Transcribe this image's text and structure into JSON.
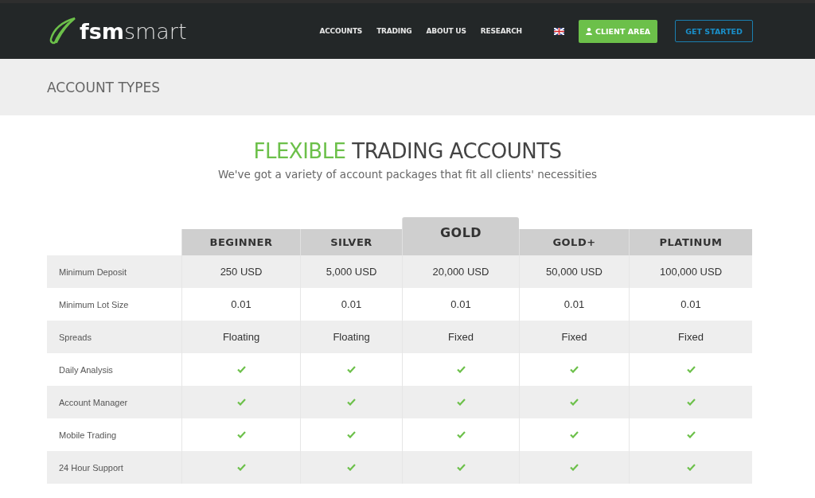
{
  "logo": {
    "bold": "fsm",
    "light": "smart"
  },
  "nav": [
    "ACCOUNTS",
    "TRADING",
    "ABOUT US",
    "RESEARCH"
  ],
  "client_button": "CLIENT AREA",
  "start_button": "GET STARTED",
  "page_title": "ACCOUNT TYPES",
  "heading": {
    "accent": "FLEXIBLE",
    "rest": "TRADING ACCOUNTS"
  },
  "subtitle": "We've got a variety of account packages that fit all clients' necessities",
  "table": {
    "columns": [
      {
        "label": "BEGINNER",
        "featured": false
      },
      {
        "label": "SILVER",
        "featured": false
      },
      {
        "label": "GOLD",
        "featured": true
      },
      {
        "label": "GOLD+",
        "featured": false
      },
      {
        "label": "PLATINUM",
        "featured": false
      }
    ],
    "rows": [
      {
        "label": "Minimum Deposit",
        "kind": "text",
        "cells": [
          "250 USD",
          "5,000 USD",
          "20,000 USD",
          "50,000 USD",
          "100,000 USD"
        ]
      },
      {
        "label": "Minimum Lot Size",
        "kind": "text",
        "cells": [
          "0.01",
          "0.01",
          "0.01",
          "0.01",
          "0.01"
        ]
      },
      {
        "label": "Spreads",
        "kind": "text",
        "cells": [
          "Floating",
          "Floating",
          "Fixed",
          "Fixed",
          "Fixed"
        ]
      },
      {
        "label": "Daily Analysis",
        "kind": "check",
        "cells": [
          true,
          true,
          true,
          true,
          true
        ]
      },
      {
        "label": "Account Manager",
        "kind": "check",
        "cells": [
          true,
          true,
          true,
          true,
          true
        ]
      },
      {
        "label": "Mobile Trading",
        "kind": "check",
        "cells": [
          true,
          true,
          true,
          true,
          true
        ]
      },
      {
        "label": "24 Hour Support",
        "kind": "check",
        "cells": [
          true,
          true,
          true,
          true,
          true
        ]
      }
    ]
  }
}
